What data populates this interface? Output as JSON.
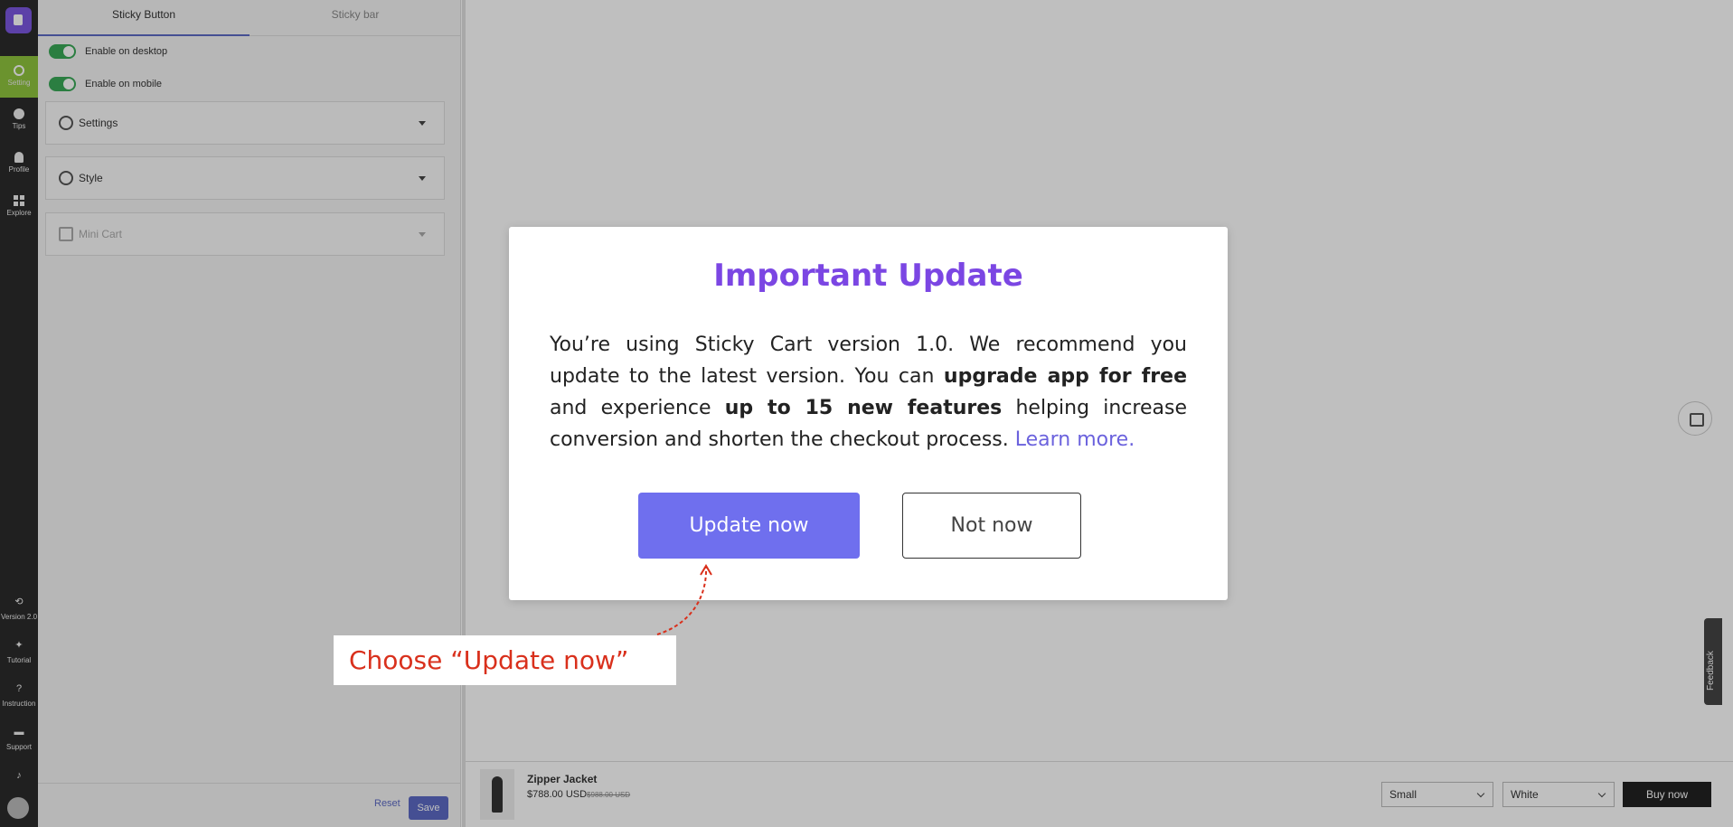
{
  "rail": {
    "items": [
      {
        "label": "Setting",
        "icon": "gear-icon"
      },
      {
        "label": "Tips",
        "icon": "lightbulb-icon"
      },
      {
        "label": "Profile",
        "icon": "person-icon"
      },
      {
        "label": "Explore",
        "icon": "grid-icon"
      }
    ],
    "bottom": [
      {
        "label": "Version 2.0",
        "icon": "refresh-icon",
        "glyph": "⟲"
      },
      {
        "label": "Tutorial",
        "icon": "bulb-icon",
        "glyph": "✦"
      },
      {
        "label": "Instruction",
        "icon": "question-icon",
        "glyph": "?"
      },
      {
        "label": "Support",
        "icon": "chat-icon",
        "glyph": "▬"
      }
    ],
    "active_color": "#8fc43e",
    "brand_color": "#7b57e0"
  },
  "panel": {
    "tabs": [
      "Sticky Button",
      "Sticky bar"
    ],
    "toggles": [
      "Enable on desktop",
      "Enable on mobile"
    ],
    "sections": [
      "Settings",
      "Style",
      "Mini Cart"
    ],
    "reset_label": "Reset",
    "save_label": "Save"
  },
  "preview": {
    "feedback_label": "Feedback",
    "product": {
      "name": "Zipper Jacket",
      "price": "$788.00 USD",
      "compare_price": "$988.00 USD"
    },
    "size_value": "Small",
    "color_value": "White",
    "buy_label": "Buy now"
  },
  "modal": {
    "title": "Important Update",
    "body_1": "You’re using Sticky Cart version 1.0. We recommend you update to the latest version. You can ",
    "body_bold_1": "upgrade app for free",
    "body_2": " and experience ",
    "body_bold_2": "up to 15 new features",
    "body_3": " helping increase conversion and shorten the checkout process. ",
    "link": "Learn more.",
    "update_label": "Update now",
    "notnow_label": "Not now",
    "title_color": "#7b46e3",
    "button_color": "#6f6fee"
  },
  "callout": {
    "text": "Choose “Update now”",
    "color": "#d9301c"
  }
}
